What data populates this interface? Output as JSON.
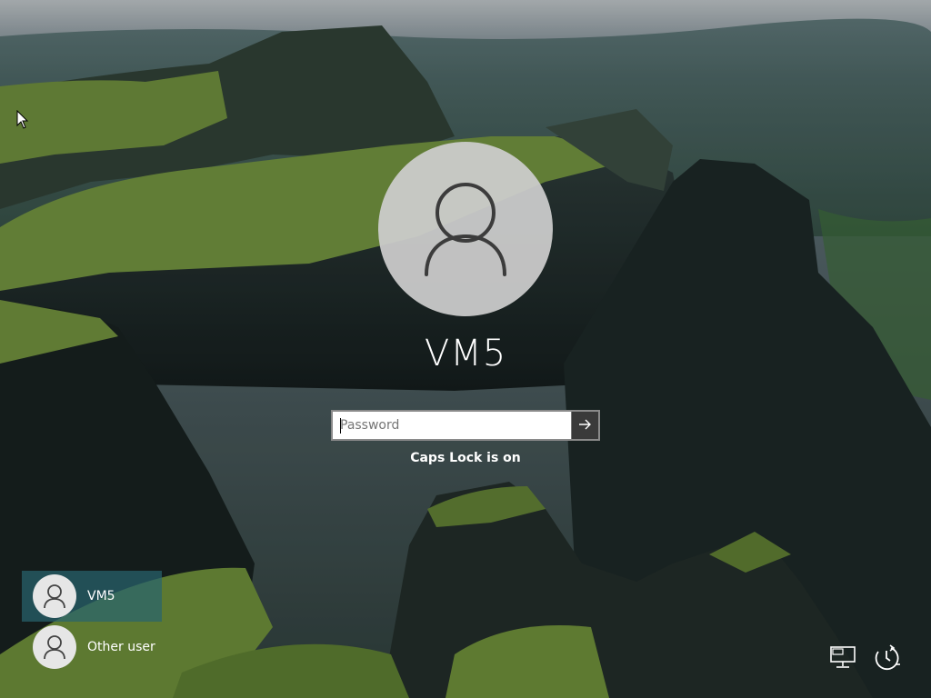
{
  "login": {
    "username": "VM5",
    "password_placeholder": "Password",
    "caps_lock_message": "Caps Lock is on"
  },
  "users": [
    {
      "label": "VM5",
      "selected": true
    },
    {
      "label": "Other user",
      "selected": false
    }
  ],
  "icons": {
    "avatar": "user-silhouette-icon",
    "submit": "arrow-right-icon",
    "network": "network-icon",
    "ease_of_access": "ease-of-access-icon",
    "cursor": "mouse-pointer-icon"
  },
  "colors": {
    "avatar_bg": "#cdcdcd",
    "selected_tile": "#28646e",
    "submit_button": "#3a3a3a"
  }
}
